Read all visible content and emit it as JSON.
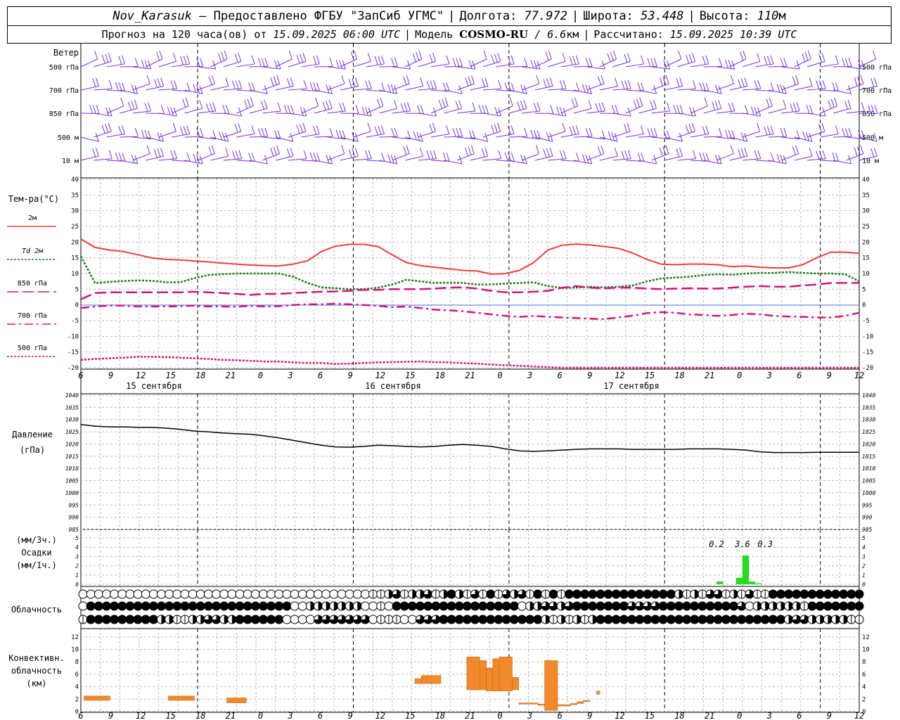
{
  "header": {
    "station": "Nov_Karasuk",
    "provider": " – Предоставлено ФГБУ \"ЗапСиб УГМС\"",
    "lon_label": "Долгота:",
    "lon_value": "77.972",
    "lat_label": "Широта:",
    "lat_value": "53.448",
    "alt_label": "Высота:",
    "alt_value": "110",
    "alt_unit": "м",
    "forecast_prefix": "Прогноз на 120 часа(ов) от",
    "forecast_time": "15.09.2025 06:00 UTC",
    "model_label": "Модель",
    "model_name": "COSMO-RU",
    "model_res": "/ 6.6",
    "model_res_unit": "км",
    "calc_label": "Рассчитано:",
    "calc_time": "15.09.2025 10:39 UTC"
  },
  "wind_panel": {
    "title": "Ветер",
    "levels": [
      "500 гПа",
      "700 гПа",
      "850 гПа",
      "500 м",
      "10  м"
    ],
    "barb_color": "#7b2fd6"
  },
  "temp_panel": {
    "title": "Тем-ра(°C)",
    "legend": [
      {
        "label": "2м",
        "color": "#f03c3c",
        "dash": "solid"
      },
      {
        "label": "Td  2м",
        "color": "#1f7a1f",
        "dash": "dotted"
      },
      {
        "label": "850 гПа",
        "color": "#d4147a",
        "dash": "longdash"
      },
      {
        "label": "700 гПа",
        "color": "#d4147a",
        "dash": "dashdot"
      },
      {
        "label": "500 гПа",
        "color": "#d4147a",
        "dash": "dotted"
      }
    ]
  },
  "pressure_panel": {
    "title": "Давление",
    "unit": "(гПа)"
  },
  "precip_panel": {
    "unit1": "(мм/3ч.)",
    "title": "Осадки",
    "unit2": "(мм/1ч.)",
    "bar_color": "#22dd22"
  },
  "cloud_panel": {
    "title": "Облачность"
  },
  "conv_panel": {
    "title1": "Конвективн.",
    "title2": "облачность",
    "unit": "(км)",
    "bar_color": "#f08a2a"
  },
  "x_axis": {
    "hour_ticks": [
      "6",
      "9",
      "12",
      "15",
      "18",
      "21",
      "0",
      "3",
      "6",
      "9",
      "12",
      "15",
      "18",
      "21",
      "0",
      "3",
      "6",
      "9",
      "12",
      "15",
      "18",
      "21",
      "0",
      "3",
      "6",
      "9",
      "12"
    ],
    "day_labels": [
      "15 сентября",
      "16 сентября",
      "17 сентября"
    ]
  },
  "chart_data": [
    {
      "type": "line",
      "title": "Тем-ра(°C)",
      "x_hours_from_start": [
        0,
        3,
        6,
        9,
        12,
        15,
        18,
        21,
        24,
        27,
        30,
        33,
        36,
        39,
        42,
        45,
        48,
        51,
        54,
        57,
        60,
        63,
        66,
        69,
        72,
        75,
        78,
        81,
        84,
        87,
        90,
        93,
        96,
        99,
        102,
        105,
        108,
        111,
        114,
        117,
        120
      ],
      "ylim": [
        -20,
        40
      ],
      "yticks": [
        -20,
        -15,
        -10,
        -5,
        0,
        5,
        10,
        15,
        20,
        25,
        30,
        35,
        40
      ],
      "series": [
        {
          "name": "2м",
          "values": [
            21,
            18.3,
            17.5,
            17,
            16,
            15,
            14.5,
            14.3,
            14,
            13.7,
            13.3,
            13,
            12.7,
            12.5,
            12.4,
            13,
            14,
            17,
            18.7,
            19.3,
            19.3,
            18.6,
            16,
            13.5,
            12.5,
            12,
            11.5,
            11,
            10.8,
            9.8,
            10,
            11,
            13.5,
            17.5,
            19,
            19.4,
            19.1,
            18.6,
            18,
            16.5,
            14.5,
            13,
            12.8,
            13,
            13,
            12.8,
            12.2,
            12.4,
            12,
            11.8,
            11.8,
            12.8,
            15,
            16.8,
            16.8,
            16.4
          ]
        },
        {
          "name": "Td  2м",
          "values": [
            15.5,
            7,
            7.3,
            7.6,
            7.8,
            7.7,
            7.2,
            7.2,
            8.5,
            9.5,
            9.8,
            10,
            10,
            10,
            10,
            9,
            7,
            5.6,
            5.3,
            5,
            5,
            5.5,
            6.5,
            8,
            7.5,
            7,
            7.1,
            7,
            6.5,
            6.5,
            6.8,
            7,
            7.2,
            6,
            5.4,
            5.5,
            5.8,
            5.6,
            5.8,
            6.2,
            7.5,
            8.4,
            8.7,
            9,
            9.5,
            9.8,
            9.6,
            10,
            10.2,
            10.2,
            10.5,
            10.2,
            10,
            10,
            9.8,
            7.5
          ]
        },
        {
          "name": "850 гПа",
          "values": [
            1.8,
            3.8,
            4,
            4,
            4,
            4,
            4,
            4,
            4.2,
            4,
            3.8,
            3.5,
            3.2,
            3.5,
            3.5,
            3.8,
            4,
            4.2,
            4.3,
            4.5,
            4.8,
            4.8,
            5,
            5,
            5,
            5.2,
            5.5,
            5.6,
            5.2,
            4.5,
            4,
            4,
            4.2,
            4.5,
            5.5,
            6,
            5.5,
            5.3,
            5.5,
            5.5,
            5.2,
            5,
            5.2,
            5.3,
            5.2,
            5.2,
            5.5,
            5.8,
            6,
            5.8,
            5.8,
            6.2,
            6.5,
            7,
            7,
            7
          ]
        },
        {
          "name": "700 гПа",
          "values": [
            -1,
            -0.5,
            -0.2,
            -0.2,
            -0.5,
            -0.5,
            -0.5,
            -0.4,
            -0.2,
            -0.5,
            -0.5,
            -0.6,
            -0.3,
            -0.5,
            -0.4,
            0,
            0.2,
            0.2,
            0.4,
            0.2,
            0,
            -0.3,
            -0.7,
            -0.5,
            -1,
            -1.5,
            -1.7,
            -2,
            -2.5,
            -3,
            -3.5,
            -3.8,
            -3.5,
            -3.8,
            -4,
            -4.2,
            -4.4,
            -4.5,
            -4,
            -3.4,
            -2.6,
            -2.3,
            -2.5,
            -3,
            -3.2,
            -3.5,
            -3.2,
            -2.8,
            -3,
            -3.5,
            -3.7,
            -3.8,
            -4,
            -4,
            -3.5,
            -2.5
          ]
        },
        {
          "name": "500 гПа",
          "values": [
            -17.5,
            -17.2,
            -17,
            -16.8,
            -16.5,
            -16.5,
            -16.6,
            -16.8,
            -17,
            -17.2,
            -17.5,
            -17.6,
            -17.8,
            -18,
            -18,
            -18.3,
            -18.5,
            -18.5,
            -18.8,
            -18.7,
            -18.5,
            -18.3,
            -18.2,
            -18.1,
            -18,
            -18.2,
            -18.3,
            -18.5,
            -18.7,
            -19,
            -19.2,
            -19.4,
            -19.6,
            -19.8,
            -20,
            -20.2,
            -20.4,
            -20.6,
            -20.8,
            -21,
            -21.2,
            -21.4,
            -21.6,
            -21.4,
            -21.2,
            -20.8,
            -20.6,
            -20.4,
            -20.4,
            -20.6,
            -20.8,
            -21,
            -21.2,
            -21.4,
            -21.6,
            -21.8
          ]
        }
      ]
    },
    {
      "type": "line",
      "title": "Давление",
      "ylabel": "(гПа)",
      "ylim": [
        985,
        1040
      ],
      "yticks": [
        985,
        990,
        995,
        1000,
        1005,
        1010,
        1015,
        1020,
        1025,
        1030,
        1035,
        1040
      ],
      "series": [
        {
          "name": "",
          "values": [
            1028,
            1027.3,
            1027,
            1027,
            1026.8,
            1026.8,
            1026.5,
            1026,
            1025.3,
            1025,
            1024.5,
            1024.2,
            1024,
            1023.3,
            1022.5,
            1021.5,
            1020.5,
            1019.5,
            1018.8,
            1018.7,
            1019,
            1019.5,
            1019.3,
            1019,
            1018.8,
            1019,
            1019.5,
            1019.8,
            1019.5,
            1019,
            1018,
            1017.2,
            1017,
            1017.2,
            1017.5,
            1017.8,
            1018,
            1018,
            1018,
            1017.8,
            1017.8,
            1017.8,
            1017.8,
            1018,
            1018,
            1018,
            1017.8,
            1017.5,
            1016.8,
            1016.5,
            1016.5,
            1016.5,
            1016.6,
            1016.6,
            1016.6,
            1016.6
          ]
        }
      ]
    },
    {
      "type": "bar",
      "title": "Осадки",
      "ylabel": "(мм/1ч.)",
      "ylim": [
        0,
        5
      ],
      "yticks": [
        0,
        1,
        2,
        3,
        4,
        5
      ],
      "bars": [
        {
          "hour": 98.5,
          "value": 0.3
        },
        {
          "hour": 101.5,
          "value": 0.7
        },
        {
          "hour": 102.5,
          "value": 3.1
        },
        {
          "hour": 103.5,
          "value": 0.3
        },
        {
          "hour": 104.5,
          "value": 0.1
        }
      ],
      "annotations": [
        {
          "hour": 98,
          "text": "0.2"
        },
        {
          "hour": 102,
          "text": "3.6"
        },
        {
          "hour": 105.5,
          "text": "0.3"
        }
      ]
    },
    {
      "type": "bar",
      "title": "Конвективн. облачность",
      "ylabel": "(км)",
      "ylim": [
        0,
        13
      ],
      "yticks": [
        0,
        2,
        4,
        6,
        8,
        10,
        12
      ],
      "bars": [
        {
          "start": 0.5,
          "end": 4.5,
          "bottom": 1.8,
          "top": 2.5
        },
        {
          "start": 13.5,
          "end": 17.5,
          "bottom": 1.8,
          "top": 2.5
        },
        {
          "start": 22.5,
          "end": 25.5,
          "bottom": 1.4,
          "top": 2.2
        },
        {
          "start": 51.5,
          "end": 52.5,
          "bottom": 4.5,
          "top": 5.3
        },
        {
          "start": 52.5,
          "end": 55.5,
          "bottom": 4.5,
          "top": 5.8
        },
        {
          "start": 59.5,
          "end": 61.5,
          "bottom": 3.5,
          "top": 8.8
        },
        {
          "start": 61.5,
          "end": 62.5,
          "bottom": 3.5,
          "top": 8.2
        },
        {
          "start": 62.5,
          "end": 63.5,
          "bottom": 3.3,
          "top": 7.0
        },
        {
          "start": 63.5,
          "end": 64.5,
          "bottom": 3.3,
          "top": 8.5
        },
        {
          "start": 64.5,
          "end": 66.5,
          "bottom": 3.3,
          "top": 8.8
        },
        {
          "start": 66.5,
          "end": 67.5,
          "bottom": 3.5,
          "top": 5.5
        },
        {
          "start": 67.5,
          "end": 70.5,
          "bottom": 1.2,
          "top": 1.4
        },
        {
          "start": 70.5,
          "end": 71.5,
          "bottom": 1.0,
          "top": 1.2
        },
        {
          "start": 71.5,
          "end": 73.5,
          "bottom": 0.2,
          "top": 8.2
        },
        {
          "start": 73.5,
          "end": 75.5,
          "bottom": 0.9,
          "top": 1.1
        },
        {
          "start": 75.5,
          "end": 76.5,
          "bottom": 1.1,
          "top": 1.3
        },
        {
          "start": 76.5,
          "end": 77.5,
          "bottom": 1.3,
          "top": 1.6
        },
        {
          "start": 77.5,
          "end": 78.5,
          "bottom": 1.6,
          "top": 1.8
        },
        {
          "start": 79.5,
          "end": 80,
          "bottom": 2.8,
          "top": 3.3
        }
      ]
    }
  ]
}
